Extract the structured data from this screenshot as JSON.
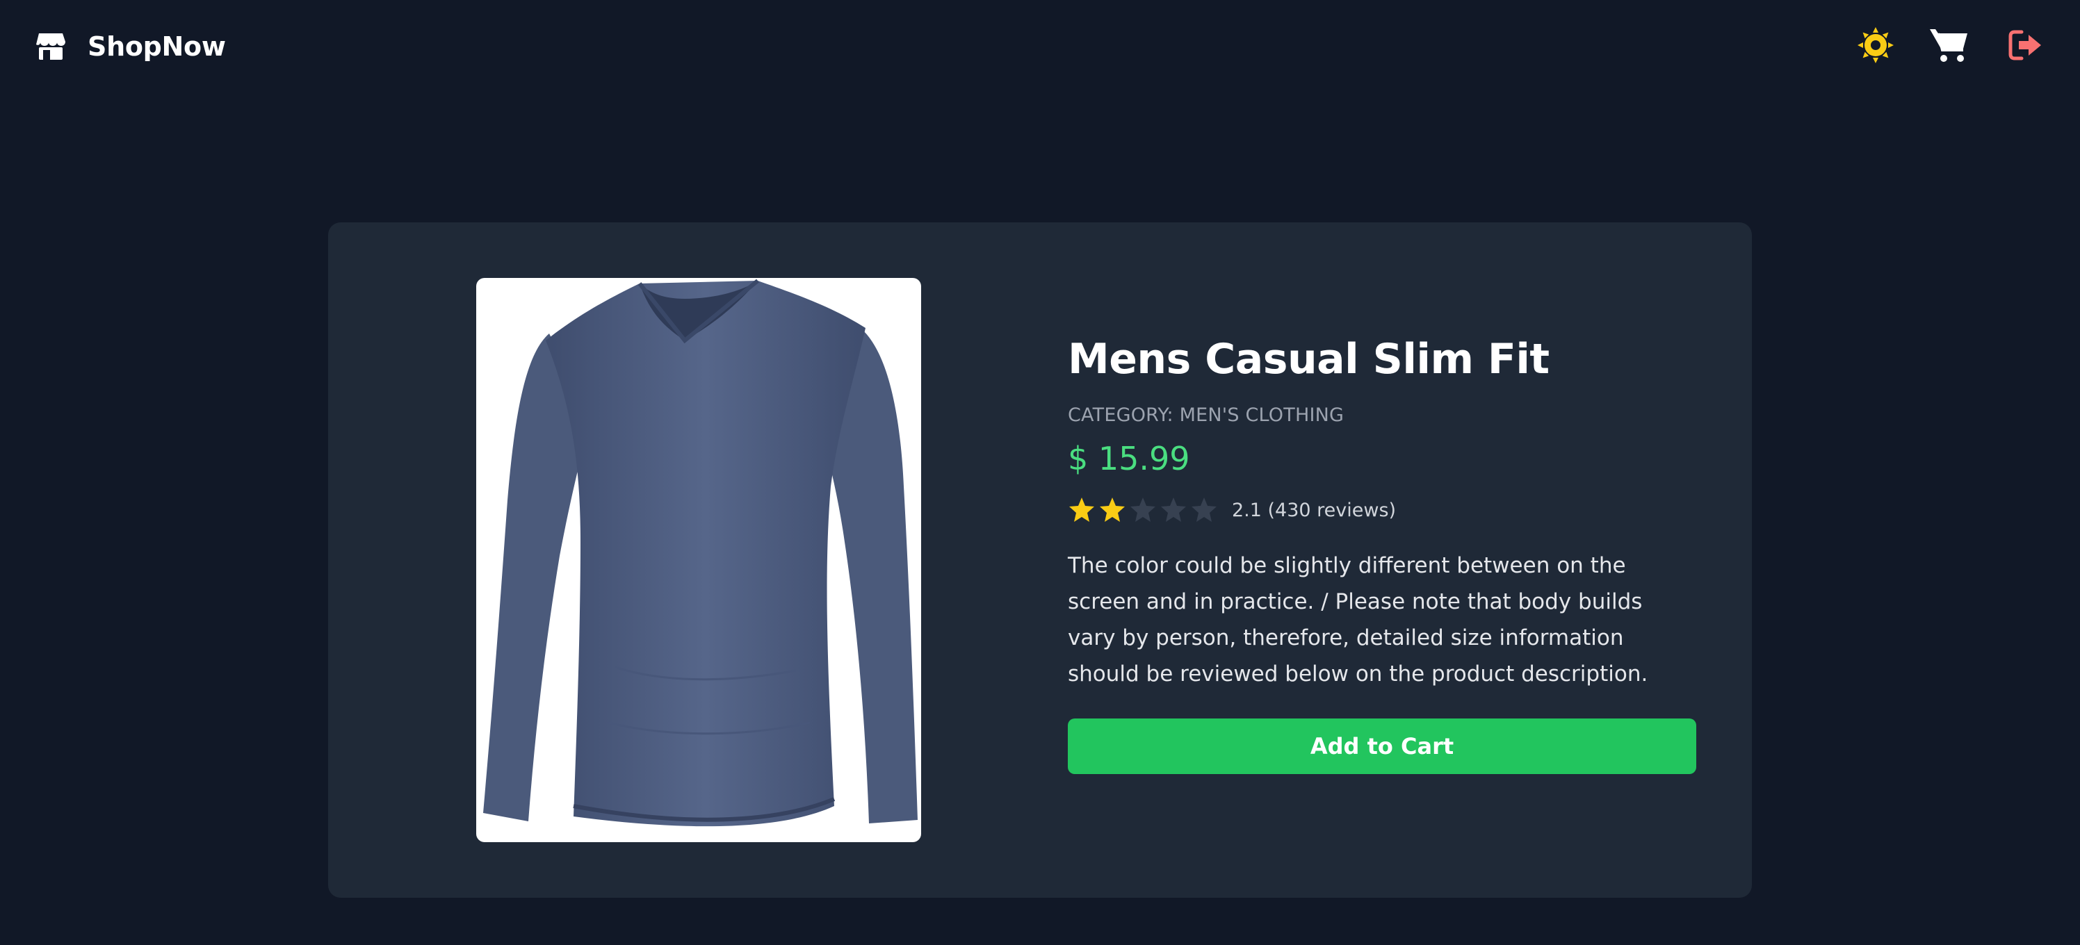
{
  "navbar": {
    "brand": "ShopNow",
    "brand_icon": "store-icon",
    "theme_icon": "sun-icon",
    "cart_icon": "cart-icon",
    "logout_icon": "logout-icon",
    "colors": {
      "theme_icon": "#facc15",
      "cart_icon": "#ffffff",
      "logout_icon": "#f87171"
    }
  },
  "product": {
    "title": "Mens Casual Slim Fit",
    "category": "CATEGORY: MEN'S CLOTHING",
    "price": "$ 15.99",
    "rating": {
      "value": 2.1,
      "max": 5,
      "filled_stars": 2,
      "text": "2.1 (430 reviews)"
    },
    "description": "The color could be slightly different between on the screen and in practice. / Please note that body builds vary by person, therefore, detailed size information should be reviewed below on the product description.",
    "image_icon": "long-sleeve-shirt-image"
  },
  "actions": {
    "add_to_cart": "Add to Cart"
  },
  "colors": {
    "background": "#111827",
    "card": "#1f2937",
    "price": "#4ade80",
    "button": "#22c55e",
    "star_filled": "#facc15",
    "star_empty": "#374151"
  }
}
